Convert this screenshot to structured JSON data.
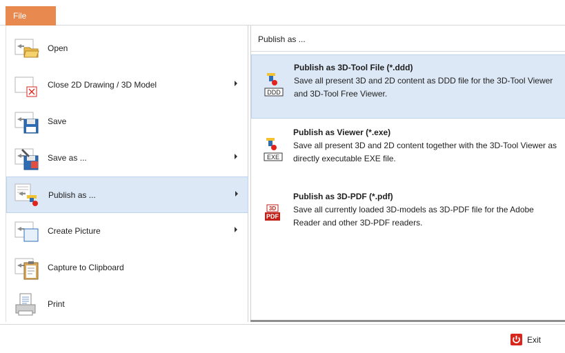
{
  "title_bar": {
    "file_tab": "File"
  },
  "left_menu": {
    "items": [
      {
        "label": "Open",
        "has_submenu": false,
        "icon": "open-folder-icon"
      },
      {
        "label": "Close 2D Drawing / 3D Model",
        "has_submenu": true,
        "icon": "close-model-icon"
      },
      {
        "label": "Save",
        "has_submenu": false,
        "icon": "save-disk-icon"
      },
      {
        "label": "Save as ...",
        "has_submenu": true,
        "icon": "save-as-icon"
      },
      {
        "label": "Publish as ...",
        "has_submenu": true,
        "icon": "publish-icon",
        "active": true
      },
      {
        "label": "Create Picture",
        "has_submenu": true,
        "icon": "picture-icon"
      },
      {
        "label": "Capture to Clipboard",
        "has_submenu": false,
        "icon": "clipboard-icon"
      },
      {
        "label": "Print",
        "has_submenu": false,
        "icon": "printer-icon"
      }
    ]
  },
  "right_panel": {
    "header": "Publish as ...",
    "items": [
      {
        "title": "Publish as 3D-Tool File (*.ddd)",
        "description": "Save all present 3D and 2D content as DDD file for the 3D-Tool Viewer and 3D-Tool Free Viewer.",
        "badge": "DDD",
        "icon": "ddd-file-icon",
        "active": true
      },
      {
        "title": "Publish as Viewer (*.exe)",
        "description": "Save all present 3D and 2D content together with the 3D-Tool Viewer as directly executable EXE file.",
        "badge": "EXE",
        "icon": "exe-file-icon"
      },
      {
        "title": "Publish as 3D-PDF (*.pdf)",
        "description": "Save all currently loaded 3D-models as 3D-PDF file for the Adobe Reader and other 3D-PDF readers.",
        "badge_top": "3D",
        "badge": "PDF",
        "icon": "pdf-file-icon"
      }
    ]
  },
  "bottom_bar": {
    "exit_label": "Exit"
  },
  "colors": {
    "accent": "#e8894f",
    "selection": "#dde8f6",
    "selection_border": "#bed3ee",
    "exit_red": "#d9261c"
  }
}
